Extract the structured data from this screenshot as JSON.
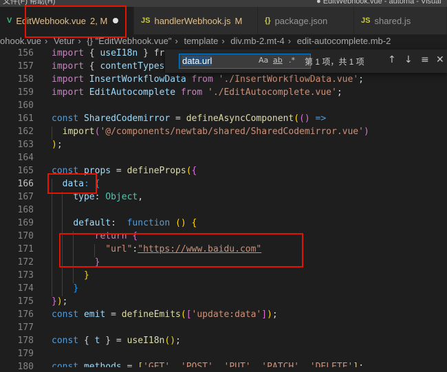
{
  "window": {
    "menu": "文件(F)   帮助(H)",
    "title": "● EditWebhook.vue - automa - Visual"
  },
  "tabs": [
    {
      "icon": "V",
      "label": "EditWebhook.vue",
      "status": "2, M"
    },
    {
      "icon": "JS",
      "label": "handlerWebhook.js",
      "status": "M"
    },
    {
      "icon": "{}",
      "label": "package.json",
      "status": ""
    },
    {
      "icon": "JS",
      "label": "shared.js",
      "status": ""
    }
  ],
  "breadcrumb": [
    "ohook.vue",
    "Vetur",
    "{} \"EditWebhook.vue\"",
    "template",
    "div.mb-2.mt-4",
    "edit-autocomplete.mb-2"
  ],
  "find": {
    "value": "data.url",
    "match_case": "Aa",
    "whole_word": "ab",
    "regex": ".*",
    "result": "第 1 项，共 1 项",
    "prev": "↑",
    "next": "↓",
    "selection": "≡",
    "close": "✕"
  },
  "line_numbers": [
    "156",
    "157",
    "158",
    "159",
    "160",
    "161",
    "162",
    "163",
    "164",
    "165",
    "166",
    "167",
    "168",
    "169",
    "170",
    "171",
    "172",
    "173",
    "174",
    "175",
    "176",
    "177",
    "178",
    "179",
    "180"
  ],
  "code": {
    "l156": {
      "kw": "import",
      "t1": " { ",
      "v1": "useI18n",
      "t2": " } fr"
    },
    "l157": {
      "kw": "import",
      "t1": " { ",
      "v1": "contentTypes"
    },
    "l158": {
      "kw": "import",
      "v1": " InsertWorkflowData ",
      "kw2": "from",
      "s1": " './InsertWorkflowData.vue'",
      "t1": ";"
    },
    "l159": {
      "kw": "import",
      "v1": " EditAutocomplete ",
      "kw2": "from",
      "s1": " './EditAutocomplete.vue'",
      "t1": ";"
    },
    "l161": {
      "kw": "const",
      "v1": " SharedCodemirror",
      "t1": " = ",
      "fn": "defineAsyncComponent",
      "p1": "(",
      "p2": "()",
      "t2": " =>"
    },
    "l162": {
      "fn": "import",
      "p3": "(",
      "s1": "'@/components/newtab/shared/SharedCodemirror.vue'",
      "p4": ")"
    },
    "l163": {
      "p1": ")",
      "t1": ";"
    },
    "l165": {
      "kw": "const",
      "v1": " props",
      "t1": " = ",
      "fn": "defineProps",
      "p1": "(",
      "p2": "{"
    },
    "l166": {
      "v1": "data",
      "t1": ": {"
    },
    "l167": {
      "v1": "type",
      "t1": ": ",
      "cls": "Object",
      "t2": ","
    },
    "l169": {
      "v1": "default",
      "t1": ":  ",
      "kw": "function",
      "t2": " ",
      "p1": "()",
      "t3": " ",
      "p2": "{"
    },
    "l170": {
      "kw": "return",
      "t1": " ",
      "p1": "{"
    },
    "l171": {
      "s1": "\"url\"",
      "t1": ":",
      "s2": "\"https://www.baidu.com\""
    },
    "l172": {
      "p1": "}"
    },
    "l173": {
      "p1": "}"
    },
    "l174": {
      "p1": "}"
    },
    "l175": {
      "p1": "}",
      "p2": ")",
      "t1": ";"
    },
    "l176": {
      "kw": "const",
      "v1": " emit",
      "t1": " = ",
      "fn": "defineEmits",
      "p1": "(",
      "p2": "[",
      "s1": "'update:data'",
      "p3": "]",
      "p4": ")",
      "t2": ";"
    },
    "l178": {
      "kw": "const",
      "t1": " { ",
      "v1": "t",
      "t2": " } = ",
      "fn": "useI18n",
      "p1": "()",
      "t3": ";"
    },
    "l180": {
      "kw": "const",
      "v1": " methods",
      "t1": " = ",
      "p1": "[",
      "s1": "'GET'",
      "t2": ", ",
      "s2": "'POST'",
      "t3": ", ",
      "s3": "'PUT'",
      "t4": ", ",
      "s4": "'PATCH'",
      "t5": ", ",
      "s5": "'DELETE'",
      "p2": "]",
      "t6": ";"
    }
  }
}
